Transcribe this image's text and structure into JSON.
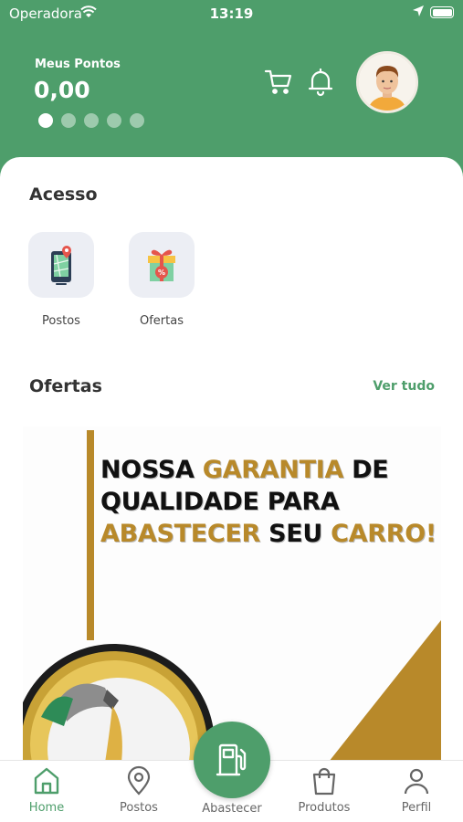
{
  "status_bar": {
    "carrier": "Operadora",
    "time": "13:19"
  },
  "header": {
    "points_label": "Meus Pontos",
    "points_value": "0,00",
    "carousel_pages": 5,
    "carousel_active": 1
  },
  "access": {
    "title": "Acesso",
    "items": [
      {
        "label": "Postos",
        "icon": "map-phone-icon"
      },
      {
        "label": "Ofertas",
        "icon": "gift-discount-icon"
      }
    ]
  },
  "offers": {
    "title": "Ofertas",
    "see_all": "Ver tudo",
    "banner": {
      "line1_part1": "NOSSA ",
      "line1_gold": "GARANTIA",
      "line1_part2": " DE",
      "line2": "QUALIDADE PARA",
      "line3_gold": "ABASTECER",
      "line3_part": " SEU ",
      "line3_gold2": "CARRO!"
    }
  },
  "bottom_nav": {
    "home": "Home",
    "postos": "Postos",
    "abastecer": "Abastecer",
    "produtos": "Produtos",
    "perfil": "Perfil"
  },
  "colors": {
    "brand": "#4e9e6b",
    "gold": "#b8892a"
  }
}
